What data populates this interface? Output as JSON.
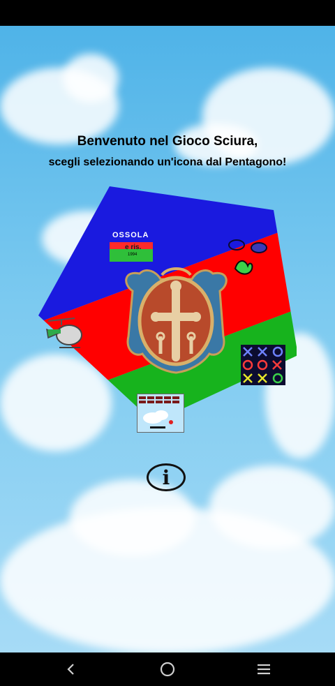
{
  "header": {
    "welcome": "Benvenuto nel Gioco Sciura,",
    "instruction": "scegli selezionando un'icona dal Pentagono!"
  },
  "pentagon": {
    "colors": {
      "blue": "#1a1adf",
      "red": "#ff0000",
      "green": "#17b31d"
    },
    "icons": {
      "ossola_label": "OSSOLA",
      "ossola_sub": "e ris.",
      "ossola_year": "1994",
      "emblem": "cross-crest-icon",
      "tictactoe": "tic-tac-toe-icon",
      "breakout": "brick-breaker-icon",
      "helicopter": "helicopter-icon",
      "hands": "hands-icon"
    }
  },
  "info": {
    "label": "i"
  },
  "navbar": {
    "back": "back-icon",
    "home": "home-icon",
    "menu": "menu-icon"
  }
}
